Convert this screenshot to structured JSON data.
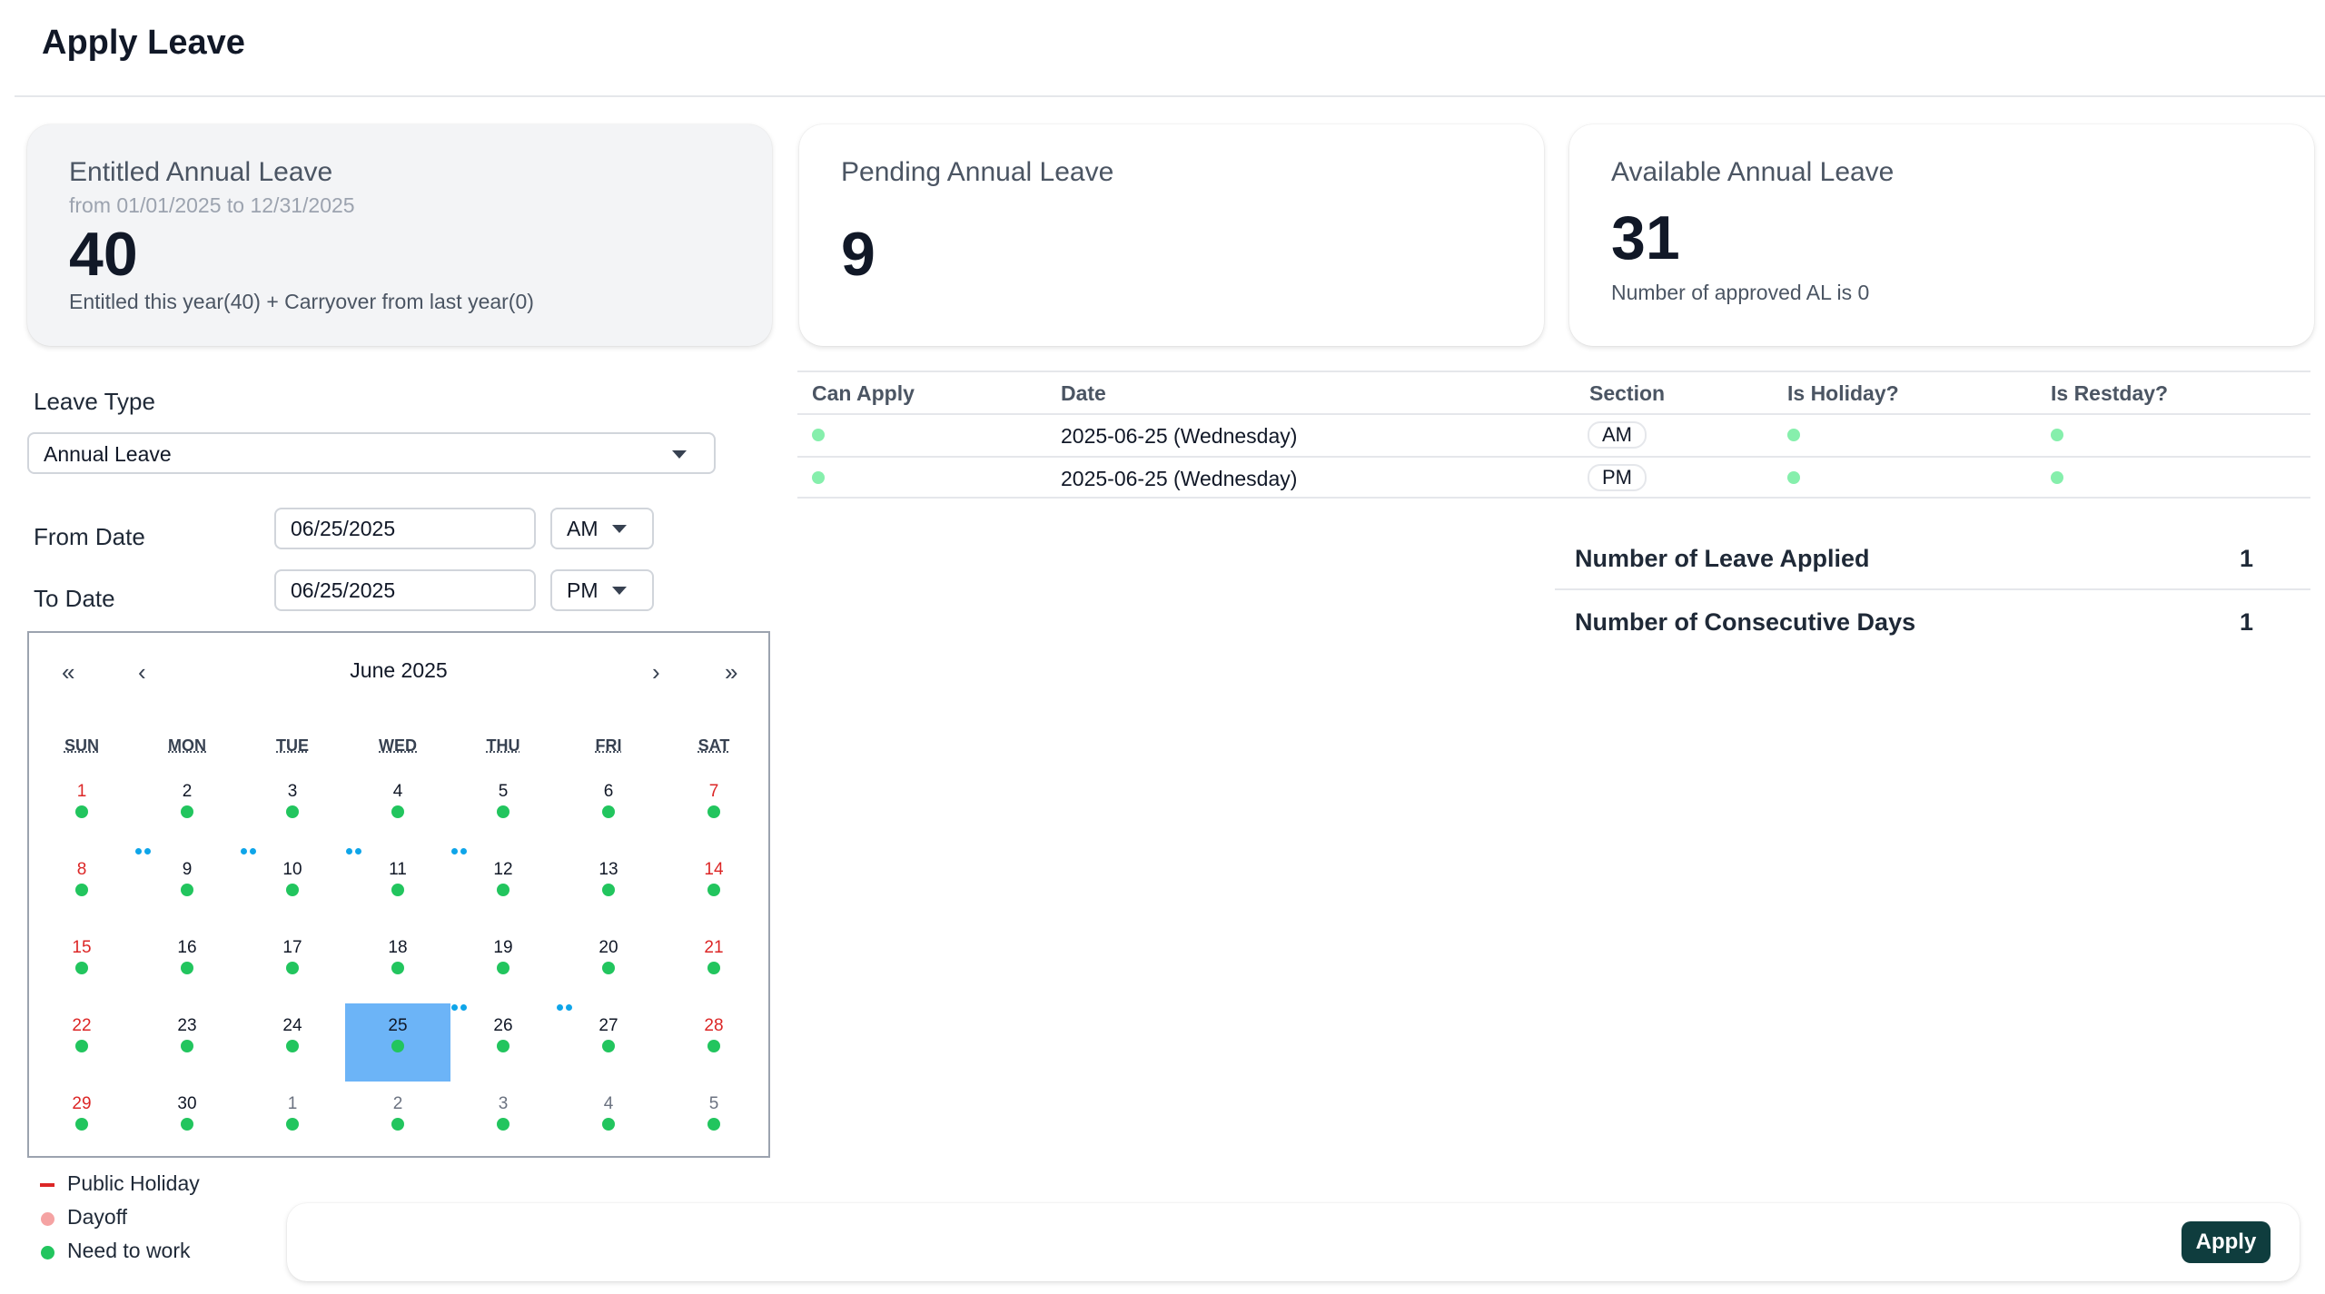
{
  "page": {
    "title": "Apply Leave"
  },
  "cards": {
    "entitled": {
      "title": "Entitled Annual Leave",
      "period": "from 01/01/2025 to 12/31/2025",
      "value": "40",
      "note": "Entitled this year(40) + Carryover from last year(0)"
    },
    "pending": {
      "title": "Pending Annual Leave",
      "value": "9"
    },
    "available": {
      "title": "Available Annual Leave",
      "value": "31",
      "note": "Number of approved AL is 0"
    }
  },
  "form": {
    "leave_type_label": "Leave Type",
    "leave_type_value": "Annual Leave",
    "from_label": "From Date",
    "from_date": "06/25/2025",
    "from_half": "AM",
    "to_label": "To Date",
    "to_date": "06/25/2025",
    "to_half": "PM"
  },
  "calendar": {
    "month_label": "June 2025",
    "nav": {
      "prev_year": "«",
      "prev_month": "‹",
      "next_month": "›",
      "next_year": "»"
    },
    "weekdays": [
      "SUN",
      "MON",
      "TUE",
      "WED",
      "THU",
      "FRI",
      "SAT"
    ],
    "weeks": [
      [
        {
          "day": "1",
          "red": true
        },
        {
          "day": "2",
          "events": true
        },
        {
          "day": "3",
          "events": true
        },
        {
          "day": "4",
          "events": true
        },
        {
          "day": "5",
          "events": true
        },
        {
          "day": "6"
        },
        {
          "day": "7",
          "red": true
        }
      ],
      [
        {
          "day": "8",
          "red": true
        },
        {
          "day": "9"
        },
        {
          "day": "10"
        },
        {
          "day": "11"
        },
        {
          "day": "12"
        },
        {
          "day": "13"
        },
        {
          "day": "14",
          "red": true
        }
      ],
      [
        {
          "day": "15",
          "red": true
        },
        {
          "day": "16"
        },
        {
          "day": "17"
        },
        {
          "day": "18",
          "events": true
        },
        {
          "day": "19",
          "events": true
        },
        {
          "day": "20",
          "events": true
        },
        {
          "day": "21",
          "red": true
        }
      ],
      [
        {
          "day": "22",
          "red": true
        },
        {
          "day": "23"
        },
        {
          "day": "24"
        },
        {
          "day": "25",
          "selected": true
        },
        {
          "day": "26"
        },
        {
          "day": "27"
        },
        {
          "day": "28",
          "red": true
        }
      ],
      [
        {
          "day": "29",
          "red": true
        },
        {
          "day": "30"
        },
        {
          "day": "1",
          "other": true
        },
        {
          "day": "2",
          "other": true
        },
        {
          "day": "3",
          "other": true
        },
        {
          "day": "4",
          "other": true
        },
        {
          "day": "5",
          "other": true
        }
      ]
    ]
  },
  "legend": [
    {
      "label": "Public Holiday",
      "type": "dash",
      "color": "#dc2626"
    },
    {
      "label": "Dayoff",
      "type": "dot",
      "color": "#f5a3a3"
    },
    {
      "label": "Need to work",
      "type": "dot",
      "color": "#22c55e"
    }
  ],
  "table": {
    "headers": [
      "Can Apply",
      "Date",
      "Section",
      "Is Holiday?",
      "Is Restday?"
    ],
    "rows": [
      {
        "date": "2025-06-25 (Wednesday)",
        "section": "AM"
      },
      {
        "date": "2025-06-25 (Wednesday)",
        "section": "PM"
      }
    ]
  },
  "summary": {
    "applied_label": "Number of Leave Applied",
    "applied_value": "1",
    "consecutive_label": "Number of Consecutive Days",
    "consecutive_value": "1"
  },
  "actions": {
    "apply_label": "Apply"
  },
  "colors": {
    "accent_button": "#0f3d3e",
    "selected_day": "#6cb4f7",
    "work_dot": "#22c55e",
    "event_dot": "#0ea5e9",
    "holiday_red": "#dc2626",
    "can_apply_dot": "#86efac"
  }
}
